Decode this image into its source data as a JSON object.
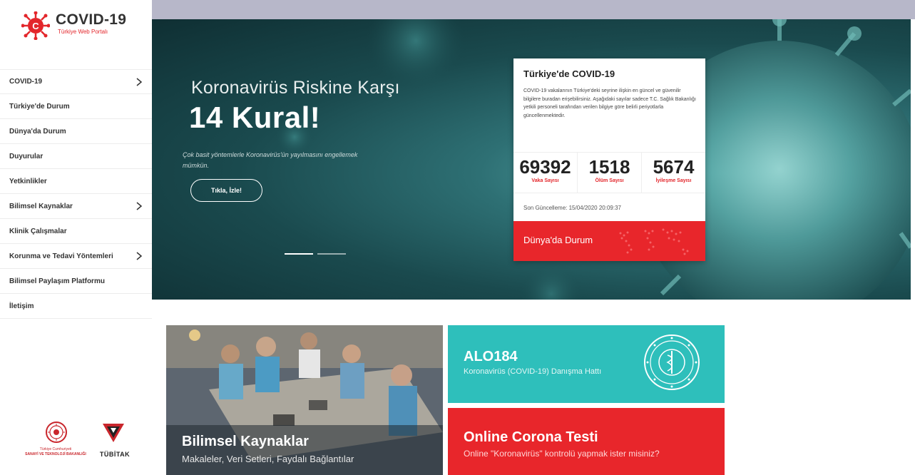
{
  "brand": {
    "title": "COVID-19",
    "subtitle": "Türkiye Web Portalı",
    "accent_color": "#e3262b"
  },
  "sidebar": {
    "items": [
      {
        "label": "COVID-19",
        "has_submenu": true
      },
      {
        "label": "Türkiye'de Durum",
        "has_submenu": false
      },
      {
        "label": "Dünya'da Durum",
        "has_submenu": false
      },
      {
        "label": "Duyurular",
        "has_submenu": false
      },
      {
        "label": "Yetkinlikler",
        "has_submenu": false
      },
      {
        "label": "Bilimsel Kaynaklar",
        "has_submenu": true
      },
      {
        "label": "Klinik Çalışmalar",
        "has_submenu": false
      },
      {
        "label": "Korunma ve Tedavi Yöntemleri",
        "has_submenu": true
      },
      {
        "label": "Bilimsel Paylaşım Platformu",
        "has_submenu": false
      },
      {
        "label": "İletişim",
        "has_submenu": false
      }
    ],
    "footer": {
      "ministry_line1": "Türkiye Cumhuriyeti",
      "ministry_line2": "SANAYİ VE TEKNOLOJİ BAKANLIĞI",
      "tubitak": "TÜBİTAK"
    }
  },
  "hero": {
    "headline_line1": "Koronavirüs Riskine Karşı",
    "headline_line2": "14 Kural!",
    "description": "Çok basit yöntemlerle Koronavirüs'ün yayılmasını engellemek mümkün.",
    "button_label": "Tıkla, İzle!",
    "slides_total": 2,
    "active_slide": 1
  },
  "stats_card": {
    "title": "Türkiye'de COVID-19",
    "text": "COVID-19 vakalarının Türkiye'deki seyrine ilişkin en güncel ve güvenilir bilgilere buradan erişebilirsiniz. Aşağıdaki sayılar sadece T.C. Sağlık Bakanlığı yetkili personeli tarafından verilen bilgiye göre belirli periyotlarla güncellenmektedir.",
    "stats": [
      {
        "value": "69392",
        "label": "Vaka Sayısı"
      },
      {
        "value": "1518",
        "label": "Ölüm Sayısı"
      },
      {
        "value": "5674",
        "label": "İyileşme Sayısı"
      }
    ],
    "updated": "Son Güncelleme: 15/04/2020 20:09:37",
    "world_link": "Dünya'da Durum"
  },
  "tiles": {
    "resources": {
      "title": "Bilimsel Kaynaklar",
      "subtitle": "Makaleler, Veri Setleri, Faydalı Bağlantılar"
    },
    "alo": {
      "title": "ALO184",
      "subtitle": "Koronavirüs (COVID-19) Danışma Hattı",
      "color": "#2ebfbb"
    },
    "corona_test": {
      "title": "Online Corona Testi",
      "subtitle": "Online \"Koronavirüs\" kontrolü yapmak ister misiniz?",
      "color": "#e8262b"
    }
  }
}
